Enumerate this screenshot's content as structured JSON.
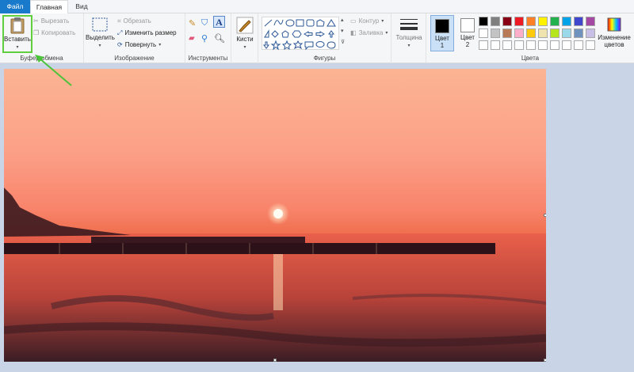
{
  "tabs": {
    "file": "Файл",
    "home": "Главная",
    "view": "Вид"
  },
  "clipboard": {
    "paste": "Вставить",
    "cut": "Вырезать",
    "copy": "Копировать",
    "label": "Буфер обмена"
  },
  "image": {
    "select": "Выделить",
    "crop": "Обрезать",
    "resize": "Изменить размер",
    "rotate": "Повернуть",
    "label": "Изображение"
  },
  "tools": {
    "label": "Инструменты",
    "brushes": "Кисти"
  },
  "shapes": {
    "outline": "Контур",
    "fill": "Заливка",
    "label": "Фигуры"
  },
  "size": {
    "label": "Толщина"
  },
  "colors": {
    "color1": "Цвет",
    "color1_num": "1",
    "color2": "Цвет",
    "color2_num": "2",
    "edit": "Изменение цветов",
    "label": "Цвета",
    "color1_value": "#000000",
    "color2_value": "#ffffff",
    "palette_row1": [
      "#000000",
      "#7f7f7f",
      "#880015",
      "#ed1c24",
      "#ff7f27",
      "#fff200",
      "#22b14c",
      "#00a2e8",
      "#3f48cc",
      "#a349a4"
    ],
    "palette_row2": [
      "#ffffff",
      "#c3c3c3",
      "#b97a57",
      "#ffaec9",
      "#ffc90e",
      "#efe4b0",
      "#b5e61d",
      "#99d9ea",
      "#7092be",
      "#c8bfe7"
    ],
    "palette_row3": [
      "#ffffff",
      "#ffffff",
      "#ffffff",
      "#ffffff",
      "#ffffff",
      "#ffffff",
      "#ffffff",
      "#ffffff",
      "#ffffff",
      "#ffffff"
    ]
  },
  "accent": {
    "file_tab": "#1979ca",
    "highlight": "#5fcf3e"
  }
}
